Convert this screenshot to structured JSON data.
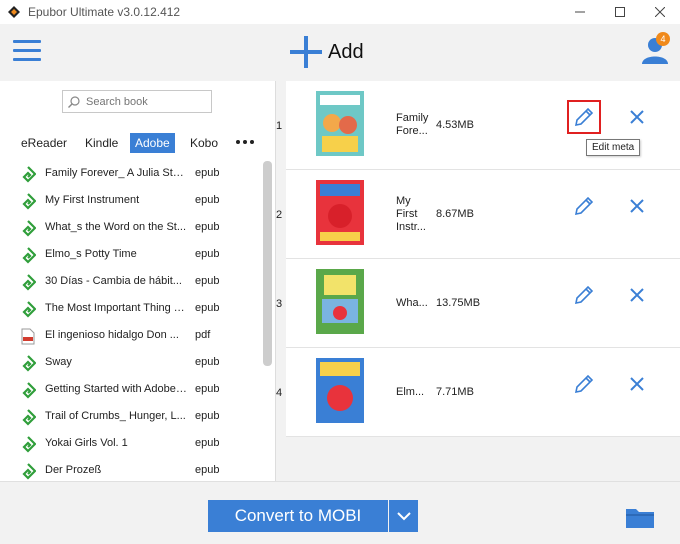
{
  "window": {
    "title": "Epubor Ultimate v3.0.12.412"
  },
  "header": {
    "add_label": "Add",
    "notification_count": "4"
  },
  "sidebar": {
    "search_placeholder": "Search book",
    "tabs": [
      {
        "label": "eReader",
        "active": false
      },
      {
        "label": "Kindle",
        "active": false
      },
      {
        "label": "Adobe",
        "active": true
      },
      {
        "label": "Kobo",
        "active": false
      }
    ],
    "books": [
      {
        "name": "Family Forever_ A Julia Sto...",
        "format": "epub",
        "icon": "epub-icon"
      },
      {
        "name": "My First Instrument",
        "format": "epub",
        "icon": "epub-icon"
      },
      {
        "name": "What_s the Word on the St...",
        "format": "epub",
        "icon": "epub-icon"
      },
      {
        "name": "Elmo_s Potty Time",
        "format": "epub",
        "icon": "epub-icon"
      },
      {
        "name": "30 Días - Cambia de hábit...",
        "format": "epub",
        "icon": "epub-icon"
      },
      {
        "name": "The Most Important Thing Y...",
        "format": "epub",
        "icon": "epub-icon"
      },
      {
        "name": "El ingenioso hidalgo Don ...",
        "format": "pdf",
        "icon": "pdf-icon"
      },
      {
        "name": "Sway",
        "format": "epub",
        "icon": "epub-icon"
      },
      {
        "name": "Getting Started with Adobe ...",
        "format": "epub",
        "icon": "epub-icon"
      },
      {
        "name": "Trail of Crumbs_ Hunger, L...",
        "format": "epub",
        "icon": "epub-icon"
      },
      {
        "name": "Yokai Girls Vol. 1",
        "format": "epub",
        "icon": "epub-icon"
      },
      {
        "name": "Der Prozeß",
        "format": "epub",
        "icon": "epub-icon"
      }
    ]
  },
  "main": {
    "entries": [
      {
        "index": "1",
        "title_lines": [
          "Family",
          "Fore..."
        ],
        "size": "4.53MB"
      },
      {
        "index": "2",
        "title_lines": [
          "My",
          "First",
          "Instr..."
        ],
        "size": "8.67MB"
      },
      {
        "index": "3",
        "title_lines": [
          "Wha..."
        ],
        "size": "13.75MB"
      },
      {
        "index": "4",
        "title_lines": [
          "Elm..."
        ],
        "size": "7.71MB"
      }
    ],
    "tooltip": "Edit meta"
  },
  "bottom": {
    "convert_label": "Convert to MOBI"
  },
  "colors": {
    "accent": "#3a7fd5",
    "epub_green": "#2f9e3a",
    "pdf_red": "#d23b2e",
    "highlight": "#e02020"
  }
}
